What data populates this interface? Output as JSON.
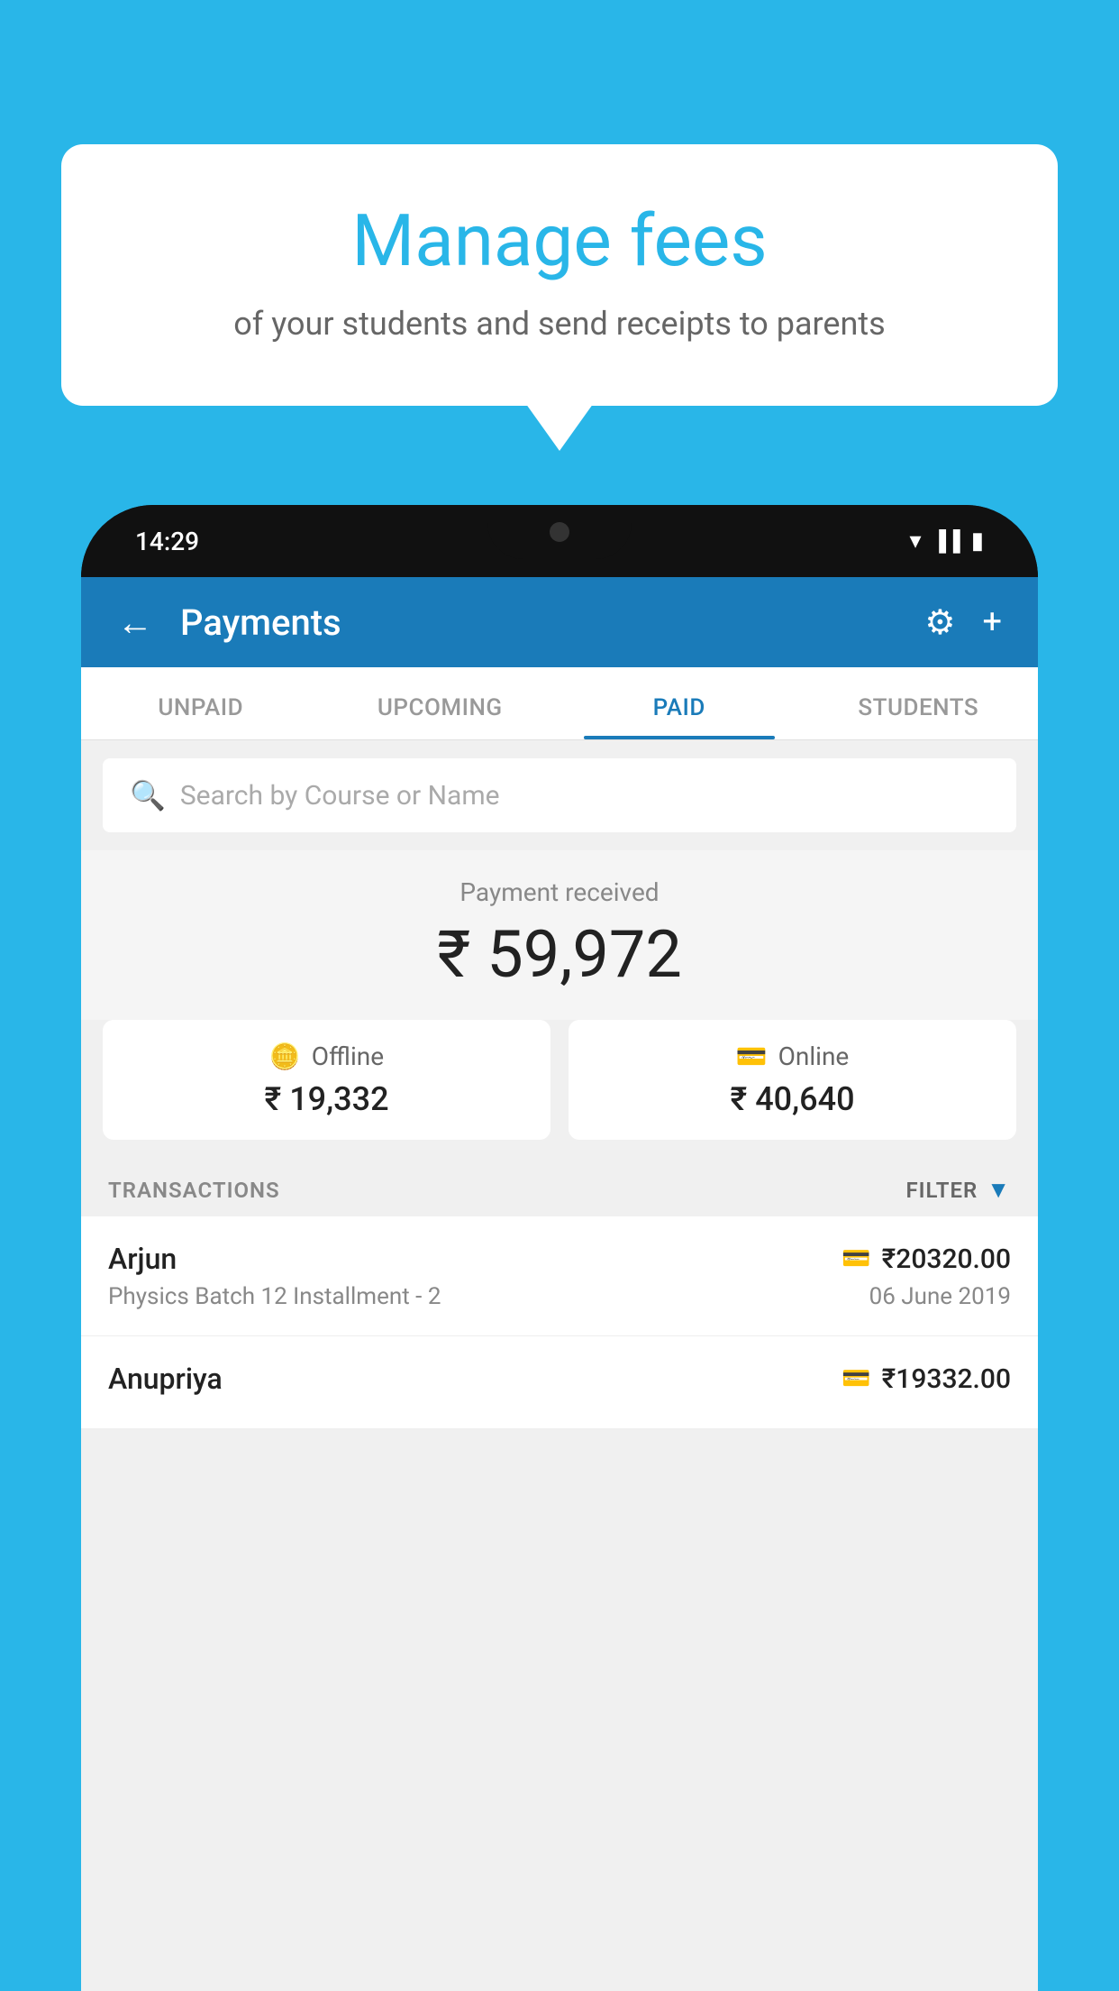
{
  "background_color": "#29b6e8",
  "bubble": {
    "title": "Manage fees",
    "subtitle": "of your students and send receipts to parents"
  },
  "phone": {
    "status_bar": {
      "time": "14:29",
      "wifi": "▾",
      "signal": "▐▐",
      "battery": "▮"
    },
    "header": {
      "title": "Payments",
      "back_label": "←",
      "gear_label": "⚙",
      "plus_label": "+"
    },
    "tabs": [
      {
        "label": "UNPAID",
        "active": false
      },
      {
        "label": "UPCOMING",
        "active": false
      },
      {
        "label": "PAID",
        "active": true
      },
      {
        "label": "STUDENTS",
        "active": false
      }
    ],
    "search": {
      "placeholder": "Search by Course or Name"
    },
    "payment_received": {
      "label": "Payment received",
      "amount": "₹ 59,972"
    },
    "payment_cards": [
      {
        "type": "Offline",
        "icon": "💳",
        "amount": "₹ 19,332"
      },
      {
        "type": "Online",
        "icon": "💳",
        "amount": "₹ 40,640"
      }
    ],
    "transactions_label": "TRANSACTIONS",
    "filter_label": "FILTER",
    "transactions": [
      {
        "name": "Arjun",
        "course": "Physics Batch 12 Installment - 2",
        "date": "06 June 2019",
        "amount": "₹20320.00",
        "icon": "💳"
      },
      {
        "name": "Anupriya",
        "course": "",
        "date": "",
        "amount": "₹19332.00",
        "icon": "💳"
      }
    ]
  }
}
